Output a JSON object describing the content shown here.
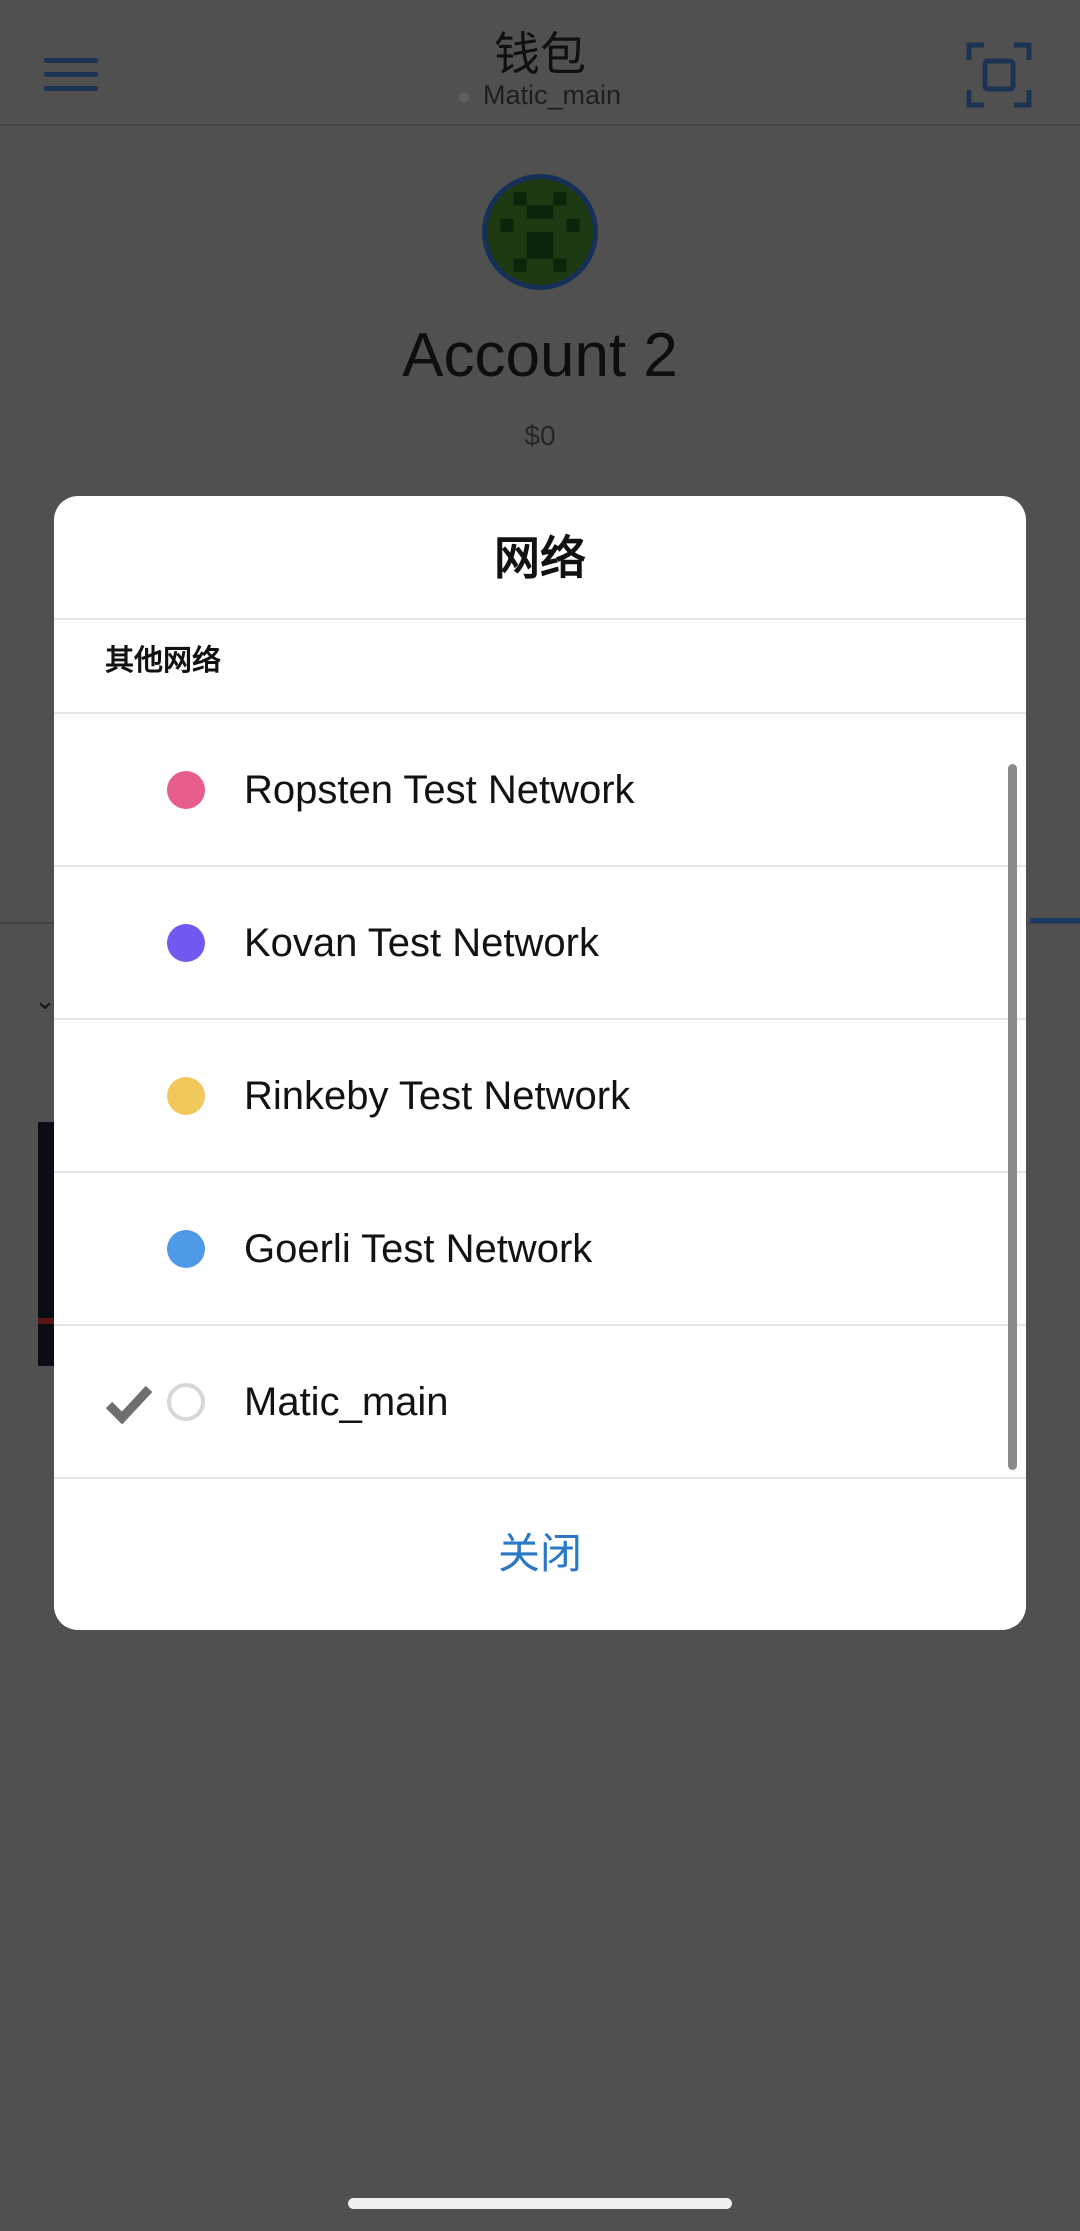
{
  "header": {
    "title": "钱包",
    "network_name": "Matic_main"
  },
  "account": {
    "name": "Account 2",
    "balance": "$0"
  },
  "modal": {
    "title": "网络",
    "section_header": "其他网络",
    "networks": [
      {
        "name": "Ropsten Test Network",
        "color": "#e65c8a",
        "selected": false
      },
      {
        "name": "Kovan Test Network",
        "color": "#7258f0",
        "selected": false
      },
      {
        "name": "Rinkeby Test Network",
        "color": "#f0c85c",
        "selected": false
      },
      {
        "name": "Goerli Test Network",
        "color": "#4e9ae8",
        "selected": false
      },
      {
        "name": "Matic_main",
        "color": "#ffffff",
        "selected": true
      }
    ],
    "close_label": "关闭"
  }
}
